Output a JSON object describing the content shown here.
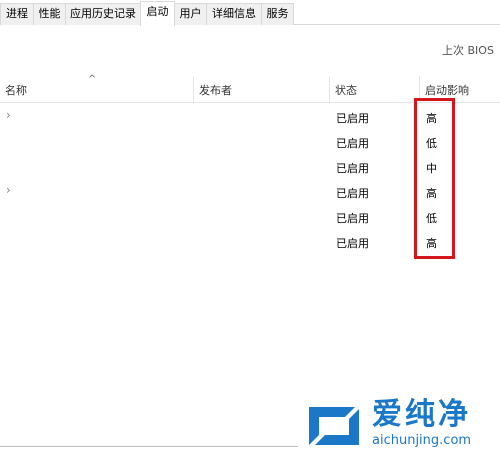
{
  "tabs": [
    {
      "label": "进程"
    },
    {
      "label": "性能"
    },
    {
      "label": "应用历史记录"
    },
    {
      "label": "启动"
    },
    {
      "label": "用户"
    },
    {
      "label": "详细信息"
    },
    {
      "label": "服务"
    }
  ],
  "active_tab": "启动",
  "bios_label": "上次 BIOS",
  "columns": {
    "name": "名称",
    "publisher": "发布者",
    "status": "状态",
    "impact": "启动影响"
  },
  "rows": [
    {
      "expandable": true,
      "status": "已启用",
      "impact": "高"
    },
    {
      "expandable": false,
      "status": "已启用",
      "impact": "低"
    },
    {
      "expandable": false,
      "status": "已启用",
      "impact": "中"
    },
    {
      "expandable": true,
      "status": "已启用",
      "impact": "高"
    },
    {
      "expandable": false,
      "status": "已启用",
      "impact": "低"
    },
    {
      "expandable": false,
      "status": "已启用",
      "impact": "高"
    }
  ],
  "icons": {
    "sort": "sort-up-icon",
    "expander": "chevron-right-icon"
  },
  "colors": {
    "highlight": "#d4161d",
    "watermark": "#1b78c8"
  },
  "watermark": {
    "brand": "爱纯净",
    "url": "aichunjing.com"
  }
}
